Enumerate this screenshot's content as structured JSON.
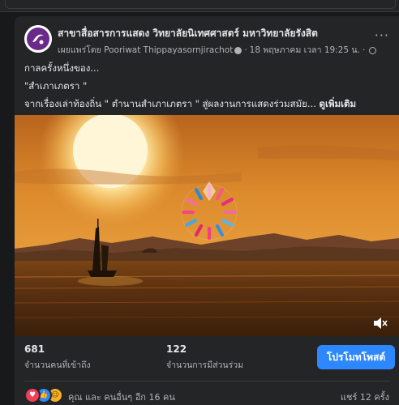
{
  "post": {
    "page_name": "สาขาสื่อสารการแสดง วิทยาลัยนิเทศศาสตร์ มหาวิทยาลัยรังสิต",
    "shared_by": "เผยแพร่โดย Pooriwat Thippayasornjirachot",
    "date": "18 พฤษภาคม เวลา 19:25 น.",
    "more_label": "···",
    "text_line1": "กาลครั้งหนึ่งของ...",
    "text_line2": "\"สำเภาเภตรา \"",
    "text_line3": "จากเรื่องเล่าท้องถิ่น \" ตำนานสำเภาเภตรา \" สู่ผลงานการแสดงร่วมสมัย...",
    "see_more": "ดูเพิ่มเติม"
  },
  "media": {
    "type": "video",
    "mute_icon": "speaker-muted-icon"
  },
  "stats": {
    "reach_value": "681",
    "reach_label": "จำนวนคนที่เข้าถึง",
    "engagement_value": "122",
    "engagement_label": "จำนวนการมีส่วนร่วม",
    "promote_label": "โปรโมทโพสต์"
  },
  "reactions": {
    "icons": [
      "love-reaction-icon",
      "like-reaction-icon",
      "haha-reaction-icon"
    ],
    "text": "คุณ และ คนอื่นๆ อีก 16 คน",
    "shares": "แชร์ 12 ครั้ง"
  },
  "colors": {
    "background": "#18191a",
    "card": "#242526",
    "primary_button": "#2d88ff",
    "secondary_text": "#b0b3b8"
  }
}
